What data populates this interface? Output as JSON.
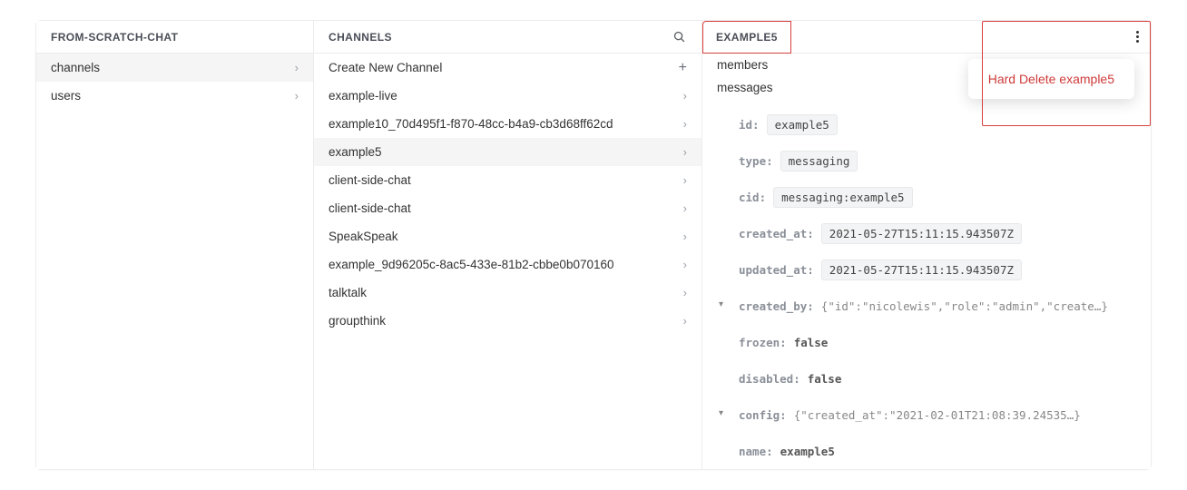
{
  "col1": {
    "title": "FROM-SCRATCH-CHAT",
    "items": [
      {
        "label": "channels",
        "selected": true
      },
      {
        "label": "users",
        "selected": false
      }
    ]
  },
  "col2": {
    "title": "CHANNELS",
    "create_label": "Create New Channel",
    "items": [
      {
        "label": "example-live"
      },
      {
        "label": "example10_70d495f1-f870-48cc-b4a9-cb3d68ff62cd"
      },
      {
        "label": "example5",
        "selected": true
      },
      {
        "label": "client-side-chat"
      },
      {
        "label": "client-side-chat"
      },
      {
        "label": "SpeakSpeak"
      },
      {
        "label": "example_9d96205c-8ac5-433e-81b2-cbbe0b070160"
      },
      {
        "label": "talktalk"
      },
      {
        "label": "groupthink"
      }
    ]
  },
  "col3": {
    "title": "EXAMPLE5",
    "subsections": {
      "members": "members",
      "messages": "messages"
    },
    "popup_label": "Hard Delete example5",
    "fields": [
      {
        "key": "id:",
        "value": "example5",
        "style": "tag"
      },
      {
        "key": "type:",
        "value": "messaging",
        "style": "tag"
      },
      {
        "key": "cid:",
        "value": "messaging:example5",
        "style": "tag"
      },
      {
        "key": "created_at:",
        "value": "2021-05-27T15:11:15.943507Z",
        "style": "tag"
      },
      {
        "key": "updated_at:",
        "value": "2021-05-27T15:11:15.943507Z",
        "style": "tag"
      },
      {
        "key": "created_by:",
        "value": "{\"id\":\"nicolewis\",\"role\":\"admin\",\"create…}",
        "style": "obj",
        "expandable": true
      },
      {
        "key": "frozen:",
        "value": "false",
        "style": "plain"
      },
      {
        "key": "disabled:",
        "value": "false",
        "style": "plain"
      },
      {
        "key": "config:",
        "value": "{\"created_at\":\"2021-02-01T21:08:39.24535…}",
        "style": "obj",
        "expandable": true
      },
      {
        "key": "name:",
        "value": "example5",
        "style": "plain"
      }
    ]
  }
}
